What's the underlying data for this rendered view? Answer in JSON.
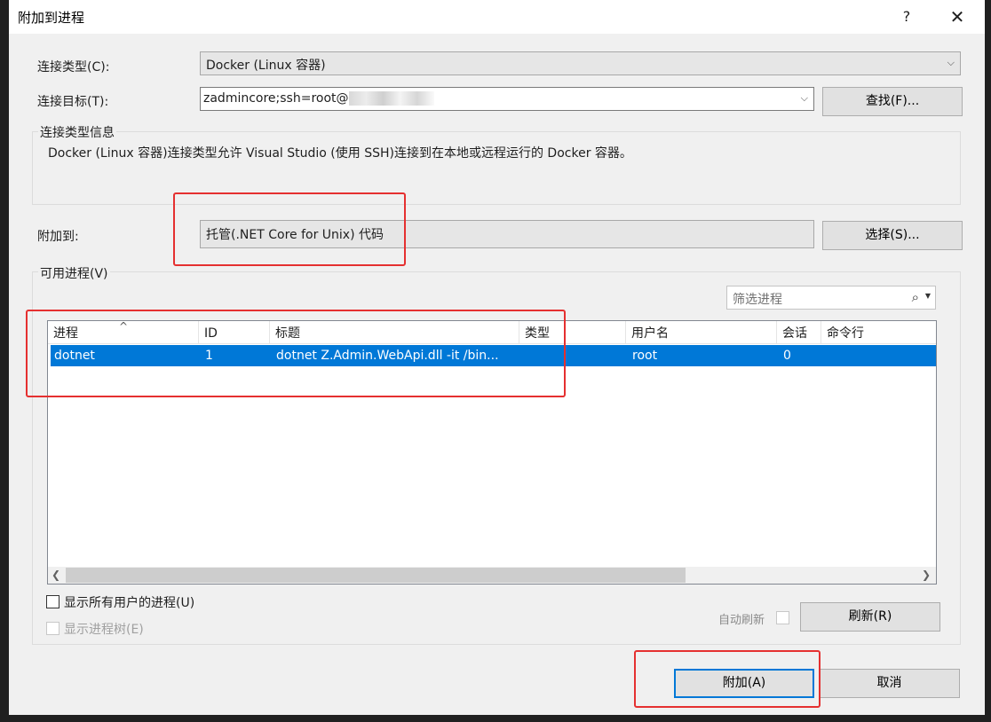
{
  "window": {
    "title": "附加到进程",
    "help": "?",
    "close": "✕"
  },
  "connection": {
    "type_label": "连接类型(C):",
    "type_value": "Docker (Linux 容器)",
    "target_label": "连接目标(T):",
    "target_value": "zadmincore;ssh=root@",
    "find_button": "查找(F)..."
  },
  "info": {
    "group_title": "连接类型信息",
    "text": "Docker (Linux 容器)连接类型允许 Visual Studio (使用 SSH)连接到在本地或远程运行的 Docker 容器。"
  },
  "attach_to": {
    "label": "附加到:",
    "value": "托管(.NET Core for Unix) 代码",
    "select_button": "选择(S)..."
  },
  "processes": {
    "group_title": "可用进程(V)",
    "filter_placeholder": "筛选进程",
    "columns": [
      "进程",
      "ID",
      "标题",
      "类型",
      "用户名",
      "会话",
      "命令行"
    ],
    "rows": [
      {
        "process": "dotnet",
        "id": "1",
        "title": "dotnet Z.Admin.WebApi.dll -it /bin...",
        "type": "",
        "user": "root",
        "session": "0",
        "cmdline": ""
      }
    ],
    "show_all_users": "显示所有用户的进程(U)",
    "show_tree": "显示进程树(E)",
    "auto_refresh": "自动刷新",
    "refresh_button": "刷新(R)"
  },
  "footer": {
    "attach_button": "附加(A)",
    "cancel_button": "取消"
  },
  "colors": {
    "selection": "#0078d7",
    "annotation_red": "#e53030"
  }
}
